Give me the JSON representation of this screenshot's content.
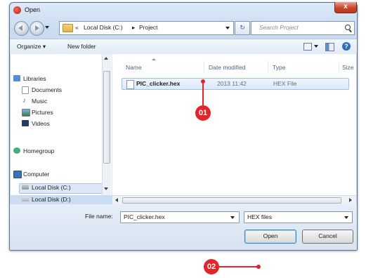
{
  "window": {
    "title": "Open",
    "close_label": "x"
  },
  "address": {
    "crumbs": [
      "«",
      "Local Disk (C:)",
      "▸",
      "Project"
    ],
    "search_placeholder": "Search Project"
  },
  "toolbar": {
    "organize": "Organize ▾",
    "new_folder": "New folder"
  },
  "nav": {
    "libraries": "Libraries",
    "documents": "Documents",
    "music": "Music",
    "pictures": "Pictures",
    "videos": "Videos",
    "homegroup": "Homegroup",
    "computer": "Computer",
    "local_c": "Local Disk (C:)",
    "local_d": "Local Disk (D:)"
  },
  "columns": {
    "name": "Name",
    "date": "Date modified",
    "type": "Type",
    "size": "Size"
  },
  "files": [
    {
      "name": "PIC_clicker.hex",
      "date": "2013 11:42",
      "type": "HEX File"
    }
  ],
  "bottom": {
    "file_name_label": "File name:",
    "file_name_value": "PIC_clicker.hex",
    "filter_value": "HEX files",
    "open_label": "Open",
    "cancel_label": "Cancel"
  },
  "callouts": {
    "first": "01",
    "second": "02"
  },
  "colors": {
    "callout": "#e3242b",
    "selection": "#dbe9f9"
  }
}
